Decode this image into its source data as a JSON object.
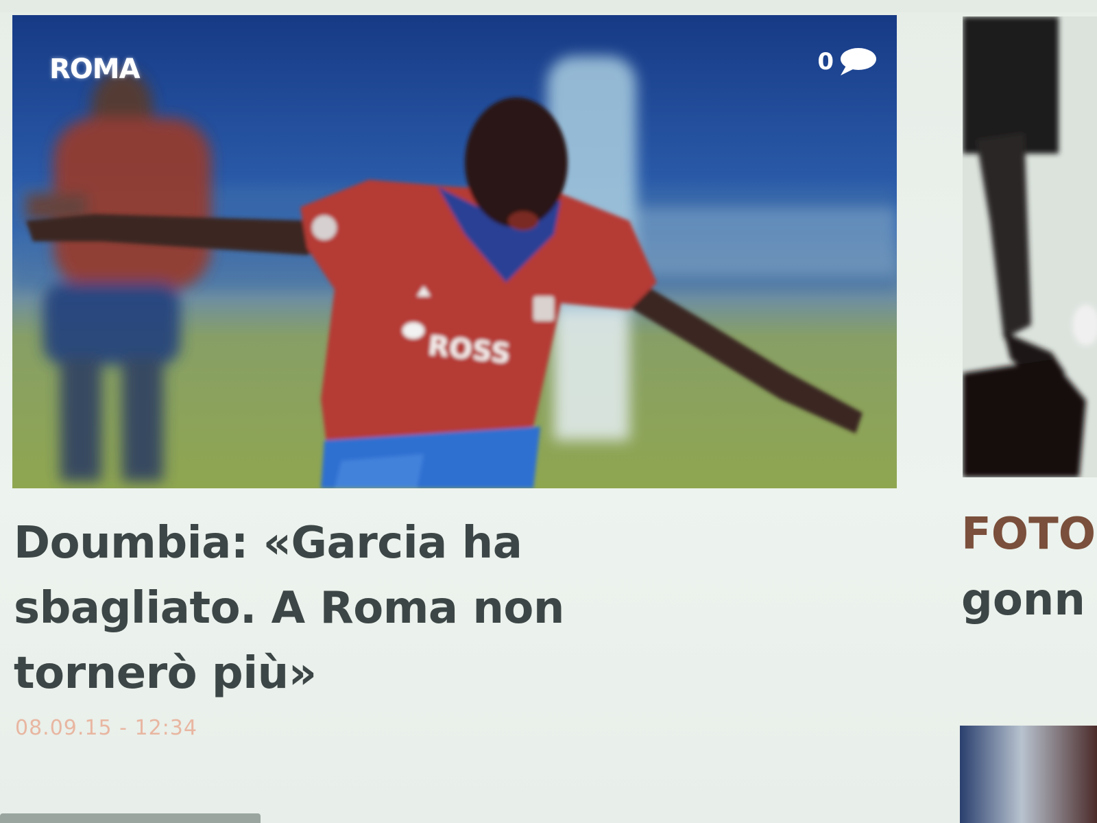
{
  "main_article": {
    "category": "ROMA",
    "comment_count": "0",
    "headline": "Doumbia: «Garcia ha sbagliato. A Roma non tornerò più»",
    "timestamp": "08.09.15 - 12:34",
    "jersey_text": "ROSS"
  },
  "side_article": {
    "title_line1": "FOTO",
    "title_line2": "gonn"
  },
  "colors": {
    "headline": "#3d4646",
    "timestamp": "#e8b6a1",
    "side_title_accent": "#7a4f3b",
    "background": "#e9f0ea"
  },
  "icons": {
    "comments": "speech-bubble-icon"
  }
}
